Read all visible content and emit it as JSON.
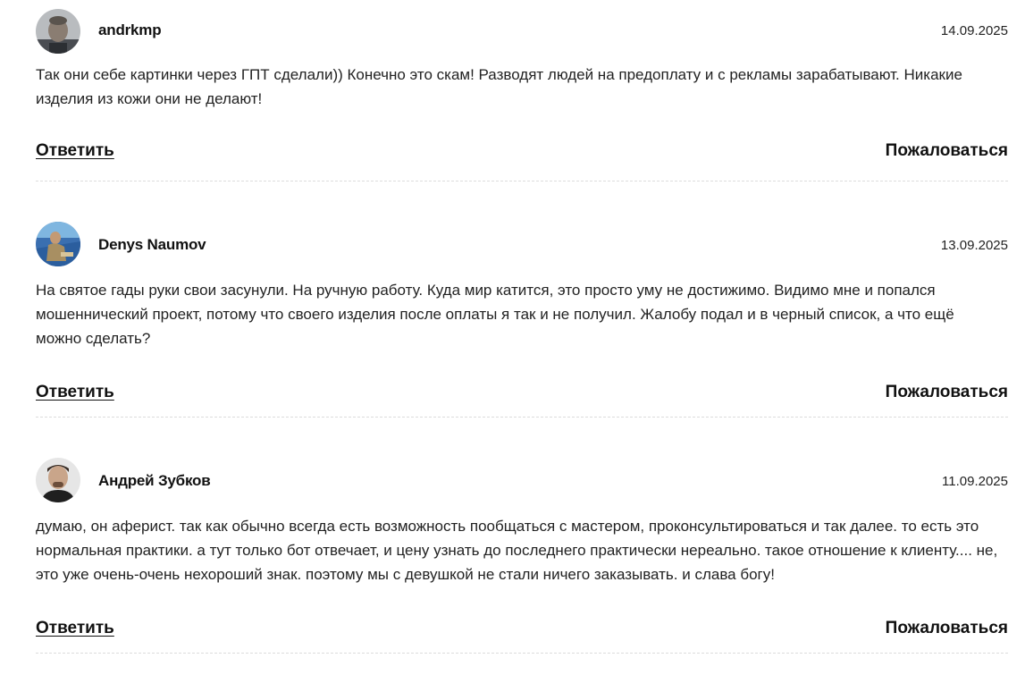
{
  "comments": [
    {
      "author": "andrkmp",
      "date": "14.09.2025",
      "text": "Так они себе картинки через ГПТ сделали)) Конечно это скам! Разводят людей на предоплату и с рекламы зарабатывают. Никакие изделия из кожи они не делают!",
      "avatar_icon": "user-photo-avatar",
      "reply_label": "Ответить",
      "report_label": "Пожаловаться"
    },
    {
      "author": "Denys Naumov",
      "date": "13.09.2025",
      "text": "На святое гады руки свои засунули. На ручную работу. Куда мир катится, это просто уму не достижимо. Видимо мне и попался мошеннический проект, потому что своего изделия после оплаты я так и не получил. Жалобу подал и в черный список, а что ещё можно сделать?",
      "avatar_icon": "user-photo-avatar",
      "reply_label": "Ответить",
      "report_label": "Пожаловаться"
    },
    {
      "author": "Андрей Зубков",
      "date": "11.09.2025",
      "text": "думаю, он аферист. так как обычно всегда есть возможность пообщаться с мастером, проконсультироваться и так далее. то есть это нормальная практики. а тут только бот отвечает, и цену узнать до последнего практически нереально. такое отношение к клиенту.... не, это уже очень-очень нехороший знак. поэтому мы с девушкой не стали ничего заказывать. и слава богу!",
      "avatar_icon": "user-photo-avatar",
      "reply_label": "Ответить",
      "report_label": "Пожаловаться"
    }
  ],
  "colors": {
    "text": "#222222",
    "divider": "#dcdcdc",
    "background": "#ffffff"
  }
}
